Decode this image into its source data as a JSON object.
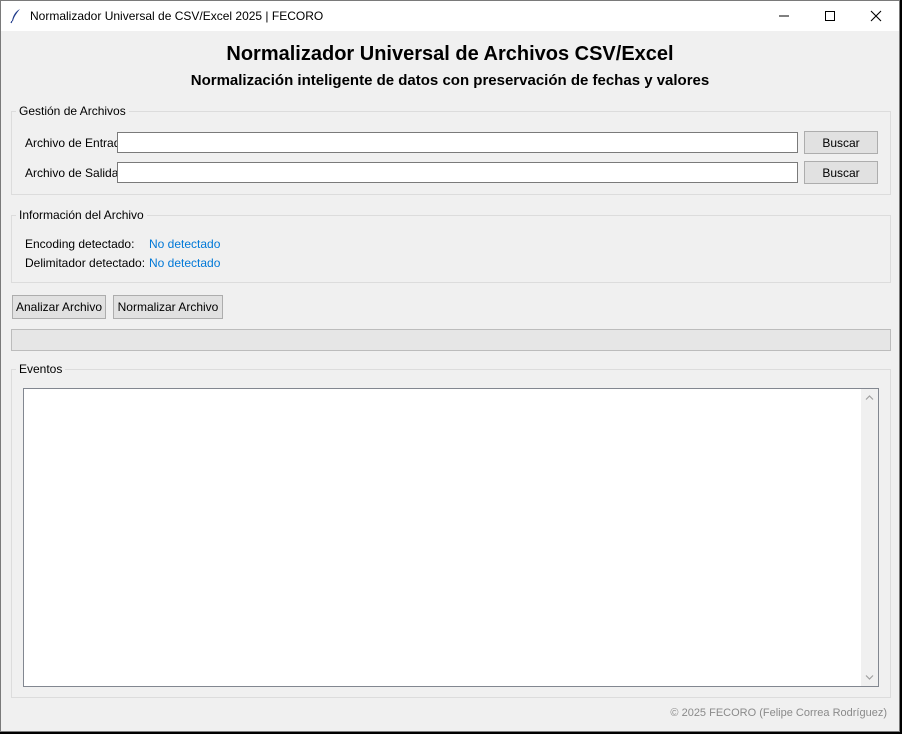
{
  "window": {
    "title": "Normalizador Universal de CSV/Excel 2025 | FECORO",
    "icon": "feather-icon",
    "controls": [
      "minimize-icon",
      "maximize-icon",
      "close-icon"
    ]
  },
  "header": {
    "title": "Normalizador Universal de Archivos CSV/Excel",
    "subtitle": "Normalización inteligente de datos con preservación de fechas y valores"
  },
  "file_management": {
    "group_label": "Gestión de Archivos",
    "input": {
      "label": "Archivo de Entrada",
      "value": "",
      "button_label": "Buscar"
    },
    "output": {
      "label": "Archivo de Salida",
      "value": "",
      "button_label": "Buscar"
    }
  },
  "file_info": {
    "group_label": "Información del Archivo",
    "encoding_label": "Encoding detectado:",
    "encoding_value": "No detectado",
    "delimiter_label": "Delimitador detectado:",
    "delimiter_value": "No detectado"
  },
  "actions": {
    "analyze_label": "Analizar Archivo",
    "normalize_label": "Normalizar Archivo"
  },
  "progress": {
    "value": 0
  },
  "events": {
    "group_label": "Eventos",
    "log_text": ""
  },
  "footer": {
    "text": "© 2025 FECORO (Felipe Correa Rodríguez)"
  },
  "colors": {
    "window_bg": "#f0f0f0",
    "info_value": "#0078d7",
    "footer_text": "#8a8a8a"
  }
}
